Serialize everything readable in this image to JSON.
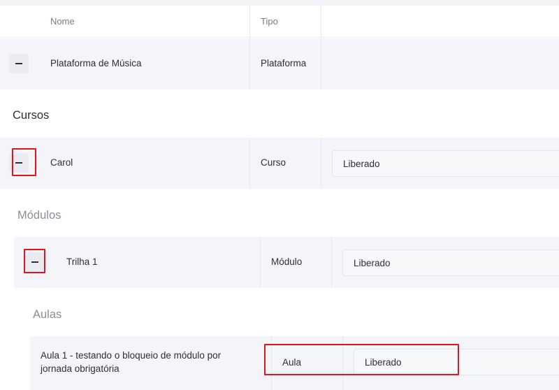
{
  "table": {
    "headers": {
      "nome": "Nome",
      "tipo": "Tipo"
    }
  },
  "platform_row": {
    "name": "Plataforma de Música",
    "type": "Plataforma",
    "toggle_icon": "minus-icon"
  },
  "cursos": {
    "section_title": "Cursos",
    "row": {
      "name": "Carol",
      "type": "Curso",
      "status": "Liberado"
    }
  },
  "modulos": {
    "section_title": "Módulos",
    "row": {
      "name": "Trilha 1",
      "type": "Módulo",
      "status": "Liberado"
    }
  },
  "aulas": {
    "section_title": "Aulas",
    "row": {
      "name": "Aula 1 - testando o bloqueio de módulo por jornada obrigatória",
      "type": "Aula",
      "status": "Liberado"
    }
  },
  "colors": {
    "highlight": "#e3141b",
    "row_background": "#f4f5f8",
    "text": "#2b2f36",
    "muted_text": "#8a8e98"
  }
}
